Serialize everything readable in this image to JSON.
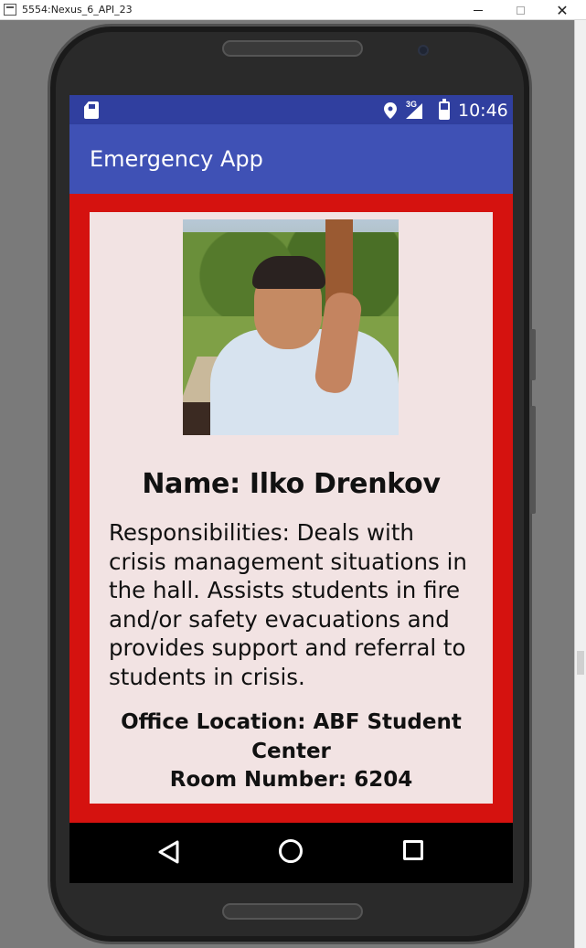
{
  "window": {
    "title": "5554:Nexus_6_API_23",
    "close_glyph": "✕"
  },
  "statusbar": {
    "network": "3G",
    "time": "10:46"
  },
  "app": {
    "title": "Emergency App"
  },
  "contact": {
    "photo_alt": "Photo of Ilko Drenkov",
    "name": "Name: Ilko Drenkov",
    "responsibilities": "Responsibilities: Deals with crisis management situations in the hall. Assists students in fire and/or safety evacuations and provides support and referral to students in crisis.",
    "office_location": "Office Location: ABF Student Center",
    "room_number": "Room Number: 6204"
  },
  "colors": {
    "statusbar": "#303f9f",
    "appbar": "#3f51b5",
    "content_background": "#d5120f",
    "card_background": "#f2e3e3"
  },
  "icons": {
    "statusbar": [
      "sd-card-icon",
      "location-icon",
      "signal-icon",
      "battery-icon"
    ],
    "navbar": [
      "back-icon",
      "home-icon",
      "recents-icon"
    ]
  }
}
